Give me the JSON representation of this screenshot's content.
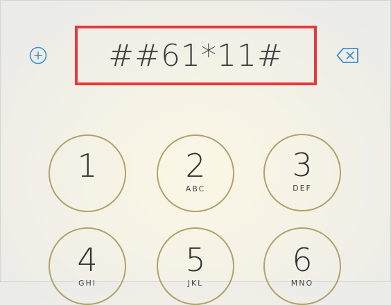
{
  "dialer": {
    "entered_number": "##61*11#",
    "add_icon": "plus-circle-icon",
    "delete_icon": "backspace-icon",
    "highlight_color": "#e8383b",
    "accent_color": "#3d8fd6",
    "key_ring_color": "#b0a26a"
  },
  "keypad": {
    "keys": [
      {
        "digit": "1",
        "letters": ""
      },
      {
        "digit": "2",
        "letters": "ABC"
      },
      {
        "digit": "3",
        "letters": "DEF"
      },
      {
        "digit": "4",
        "letters": "GHI"
      },
      {
        "digit": "5",
        "letters": "JKL"
      },
      {
        "digit": "6",
        "letters": "MNO"
      }
    ]
  }
}
